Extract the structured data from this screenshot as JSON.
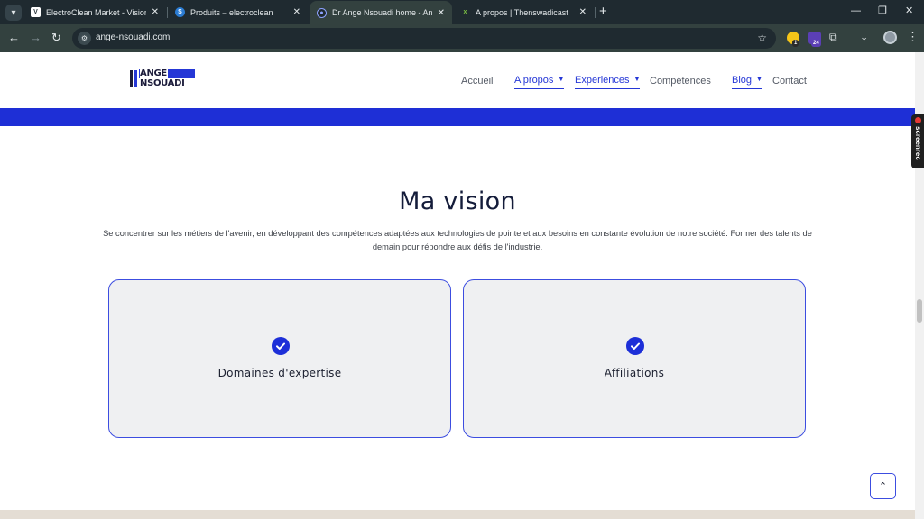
{
  "browser": {
    "tabs": [
      {
        "title": "ElectroClean Market - Vision Ma",
        "active": false,
        "favicon": "electroclean-favicon"
      },
      {
        "title": "Produits – electroclean",
        "active": false,
        "favicon": "wordpress-favicon"
      },
      {
        "title": "Dr Ange Nsouadi home - Ange",
        "active": true,
        "favicon": "ange-favicon"
      },
      {
        "title": "A propos | Thenswadicast",
        "active": false,
        "favicon": "thenswadicast-favicon"
      }
    ],
    "url": "ange-nsouadi.com",
    "extension_badges": [
      "1",
      "24"
    ]
  },
  "site": {
    "logo": {
      "line1": "ANGE",
      "line2": "NSOUADI"
    },
    "menu": [
      {
        "label": "Accueil",
        "dropdown": false,
        "active": false
      },
      {
        "label": "A propos",
        "dropdown": true,
        "active": true
      },
      {
        "label": "Experiences",
        "dropdown": true,
        "active": true
      },
      {
        "label": "Compétences",
        "dropdown": false,
        "active": false
      },
      {
        "label": "Blog",
        "dropdown": true,
        "active": true
      },
      {
        "label": "Contact",
        "dropdown": false,
        "active": false
      }
    ],
    "accent_color": "#1e2fd6"
  },
  "vision": {
    "title": "Ma vision",
    "text": "Se concentrer sur les métiers de l'avenir, en développant des compétences adaptées aux technologies de pointe et aux besoins en constante évolution de notre société. Former des talents de demain pour répondre aux défis de l'industrie.",
    "cards": [
      {
        "label": "Domaines d'expertise",
        "icon": "check-circle-icon"
      },
      {
        "label": "Affiliations",
        "icon": "check-circle-icon"
      }
    ]
  },
  "overlay": {
    "screenrec_label": "screenrec"
  }
}
